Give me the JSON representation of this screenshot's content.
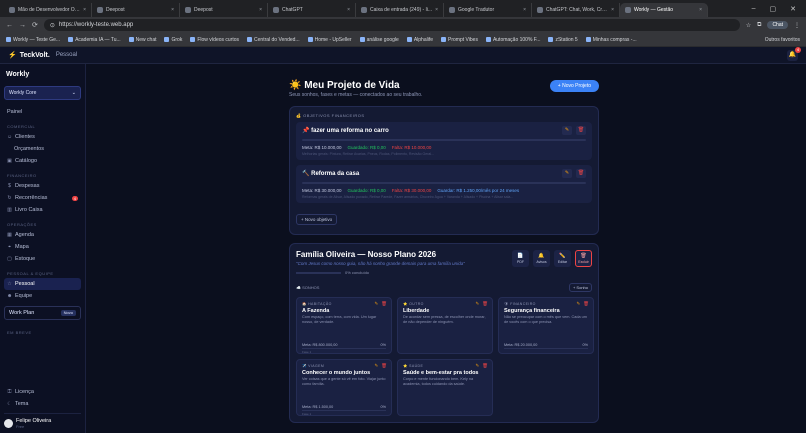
{
  "browser": {
    "tabs": [
      {
        "title": "Mão de Desenvolvedor Op...",
        "active": false
      },
      {
        "title": "Deepost",
        "active": false
      },
      {
        "title": "Deepost",
        "active": false
      },
      {
        "title": "ChatGPT",
        "active": false
      },
      {
        "title": "Caixa de entrada (249) - li...",
        "active": false
      },
      {
        "title": "Google Tradutor",
        "active": false
      },
      {
        "title": "ChatGPT: Chat, Work, Creat...",
        "active": false
      },
      {
        "title": "Workly — Gestão",
        "active": true
      }
    ],
    "url": "https://workly-teste.web.app",
    "chat_label": "Chat",
    "bookmarks": [
      "Workly — Teste Ge...",
      "Academia IA — Tu...",
      "New chat",
      "Grok",
      "Flow vídeos curtos",
      "Central do Vended...",
      "Home - UpSeller",
      "análise google",
      "Alphalife",
      "Prompt Vibes",
      "Automação 100% F...",
      "zStation 5",
      "Minhas compras -..."
    ],
    "bookmarks_other": "Outros favoritos"
  },
  "app": {
    "logo": "TeckVolt.",
    "crumb": "Pessoal",
    "bell_count": "4"
  },
  "sidebar": {
    "brand": "Workly",
    "workspace": "Workly Core",
    "items_top": [
      {
        "label": "Painel"
      }
    ],
    "sections": [
      {
        "title": "COMERCIAL",
        "items": [
          {
            "label": "Clientes",
            "sub": false
          },
          {
            "label": "Orçamentos",
            "sub": true
          },
          {
            "label": "Catálogo",
            "sub": false
          }
        ]
      },
      {
        "title": "FINANCEIRO",
        "items": [
          {
            "label": "Despesas",
            "sub": false
          },
          {
            "label": "Recorrências",
            "sub": false,
            "badge": "4"
          },
          {
            "label": "Livro Caixa",
            "sub": false
          }
        ]
      },
      {
        "title": "OPERAÇÕES",
        "items": [
          {
            "label": "Agenda",
            "sub": false
          },
          {
            "label": "Mapa",
            "sub": false
          },
          {
            "label": "Estoque",
            "sub": false
          }
        ]
      },
      {
        "title": "PESSOAL & EQUIPE",
        "items": [
          {
            "label": "Pessoal",
            "sub": false,
            "active": true
          },
          {
            "label": "Equipe",
            "sub": false
          }
        ]
      }
    ],
    "work_plan": "Work Plan",
    "work_plan_badge": "Novo",
    "em_breve": "Em breve",
    "bottom": [
      "Licença",
      "Tema"
    ],
    "user_name": "Felipe Oliveira",
    "user_role": "Free"
  },
  "page": {
    "title": "☀️ Meu Projeto de Vida",
    "subtitle": "Seus sonhos, fases e metas — conectados ao seu trabalho.",
    "new_project": "+ Novo Projeto",
    "fin_header": "💰 OBJETIVOS FINANCEIROS",
    "fin_items": [
      {
        "name": "📌 fazer uma reforma no carro",
        "meta": "Meta: R$ 10.000,00",
        "guardado": "Guardado: R$ 0,00",
        "falta": "Falta: R$ 10.000,00",
        "extra": "",
        "desc": "Melhorias gerais: Pintura, Retirar Avarias, Pneus, Rodas, Polimento, Revisão Geral..."
      },
      {
        "name": "🔨 Reforma da casa",
        "meta": "Meta: R$ 30.000,00",
        "guardado": "Guardado: R$ 0,00",
        "falta": "Falta: R$ 30.000,00",
        "extra": "Guardar: R$ 1.250,00/mês por 24 meses",
        "desc": "Reformas gerais de Alisar, Alisado puxado, Retirar Parede, Fazer armários, Chuveiro Água + Varanda + Alisado + Piscina + Alisar sala..."
      }
    ],
    "new_objective": "+ Novo objetivo",
    "family": {
      "title": "Família Oliveira — Nosso Plano 2026",
      "quote": "\"Com Jesus como nosso guia, não há sonho grande demais para uma família unida\"",
      "progress": "0% concluído",
      "actions": [
        {
          "label": "PDF",
          "glyph": "📄"
        },
        {
          "label": "Avisos",
          "glyph": "🔔"
        },
        {
          "label": "Editar",
          "glyph": "✏️"
        },
        {
          "label": "Excluir",
          "glyph": "🗑"
        }
      ],
      "sonhos_label": "☁️ SONHOS",
      "add_label": "+ Sonho",
      "dreams": [
        {
          "cat": "🏠 HABITAÇÃO",
          "name": "A Fazenda",
          "desc": "Com espaço, com terra, com vida. Um lugar nosso, de verdade.",
          "meta": "Meta: R$ 800.000,00",
          "pct": "0%",
          "step": "Fase 1"
        },
        {
          "cat": "⭐ OUTRO",
          "name": "Liberdade",
          "desc": "De acordar sem pressa, de escolher onde morar, de não depender de ninguém.",
          "meta": "",
          "pct": "",
          "step": ""
        },
        {
          "cat": "🛡 FINANCEIRO",
          "name": "Segurança financeira",
          "desc": "Não se preocupar com o mês que vem. Cada um de vocês com o que precisa.",
          "meta": "Meta: R$ 20.000,00",
          "pct": "0%",
          "step": ""
        },
        {
          "cat": "✈️ VIAGEM",
          "name": "Conhecer o mundo juntos",
          "desc": "Ver coisas que a gente só vê em foto. Viajar junto como família.",
          "meta": "Meta: R$ 1.500,00",
          "pct": "0%",
          "step": "Fase 1"
        },
        {
          "cat": "⭐ SAÚDE",
          "name": "Saúde e bem-estar pra todos",
          "desc": "Corpo e mente funcionando bem. Kely na academia, todos cuidando da saúde.",
          "meta": "",
          "pct": "",
          "step": ""
        }
      ]
    }
  },
  "colors": {
    "accent": "#3b82f6",
    "danger": "#ef4444",
    "warning": "#f59e0b",
    "success": "#22c55e"
  }
}
